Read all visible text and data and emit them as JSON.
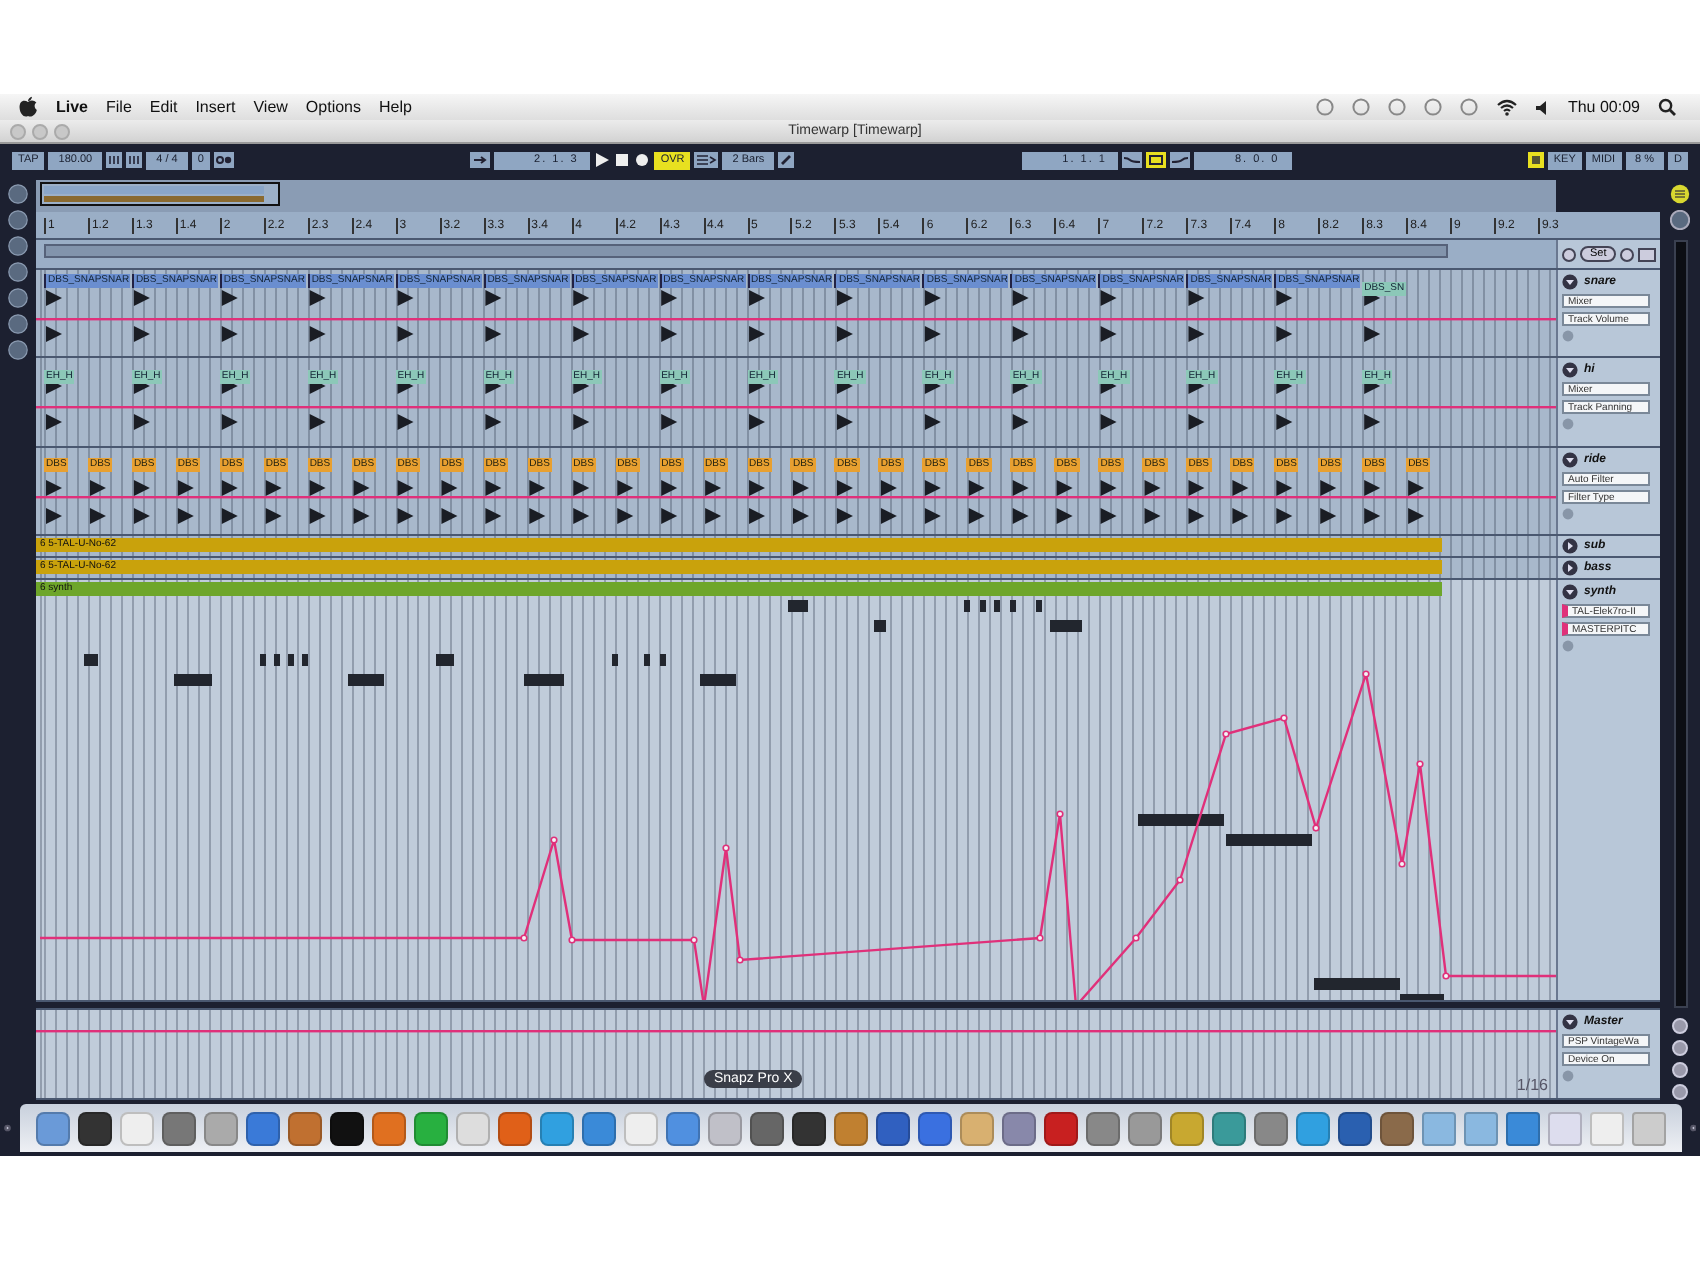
{
  "menu_bar": {
    "app": "Live",
    "items": [
      "File",
      "Edit",
      "Insert",
      "View",
      "Options",
      "Help"
    ],
    "clock": "Thu 00:09"
  },
  "window": {
    "title": "Timewarp [Timewarp]"
  },
  "transport": {
    "tap": "TAP",
    "tempo": "180.00",
    "signature": "4 / 4",
    "metronome": "0",
    "position": "2. 1. 3",
    "overdub": {
      "label": "OVR",
      "on": true
    },
    "quantize": "2 Bars",
    "loop_start": "1. 1. 1",
    "loop_length": "8. 0. 0",
    "key": "KEY",
    "midi": "MIDI",
    "cpu": "8 %",
    "disk": "D"
  },
  "ruler": {
    "labels": [
      "1",
      "1.2",
      "1.3",
      "1.4",
      "2",
      "2.2",
      "2.3",
      "2.4",
      "3",
      "3.2",
      "3.3",
      "3.4",
      "4",
      "4.2",
      "4.3",
      "4.4",
      "5",
      "5.2",
      "5.3",
      "5.4",
      "6",
      "6.2",
      "6.3",
      "6.4",
      "7",
      "7.2",
      "7.3",
      "7.4",
      "8",
      "8.2",
      "8.3",
      "8.4",
      "9",
      "9.2",
      "9.3"
    ]
  },
  "locator": {
    "set": "Set"
  },
  "tracks": [
    {
      "name": "snare",
      "kind": "drum",
      "expanded": true,
      "device": "Mixer",
      "parameter": "Track Volume",
      "clips": [
        "DBS_SNAPSNAR",
        "DBS_SNAPSNAR",
        "DBS_SNAPSNAR",
        "DBS_SNAPSNAR",
        "DBS_SNAPSNAR",
        "DBS_SNAPSNAR",
        "DBS_SNAPSNAR",
        "DBS_SNAPSNAR",
        "DBS_SNAPSNAR",
        "DBS_SNAPSNAR",
        "DBS_SNAPSNAR",
        "DBS_SNAPSNAR",
        "DBS_SNAPSNAR",
        "DBS_SNAPSNAR",
        "DBS_SNAPSNAR",
        "DBS_SN"
      ]
    },
    {
      "name": "hi",
      "kind": "drum",
      "expanded": true,
      "device": "Mixer",
      "parameter": "Track Panning",
      "clips": [
        "EH_H",
        "EH_H",
        "EH_H",
        "EH_H",
        "EH_H",
        "EH_H",
        "EH_H",
        "EH_H",
        "EH_H",
        "EH_H",
        "EH_H",
        "EH_H",
        "EH_H",
        "EH_H",
        "EH_H",
        "EH_H"
      ]
    },
    {
      "name": "ride",
      "kind": "hits",
      "expanded": true,
      "device": "Auto Filter",
      "parameter": "Filter Type",
      "clips": [
        "DBS",
        "DBS",
        "DBS",
        "DBS",
        "DBS",
        "DBS",
        "DBS",
        "DBS",
        "DBS",
        "DBS",
        "DBS",
        "DBS",
        "DBS",
        "DBS",
        "DBS",
        "DBS",
        "DBS",
        "DBS",
        "DBS",
        "DBS",
        "DBS",
        "DBS",
        "DBS",
        "DBS",
        "DBS",
        "DBS",
        "DBS",
        "DBS",
        "DBS",
        "DBS",
        "DBS",
        "DBS"
      ]
    },
    {
      "name": "sub",
      "kind": "midi",
      "expanded": false,
      "clip": {
        "label": "6 5-TAL-U-No-62",
        "color": "#c9a20c"
      }
    },
    {
      "name": "bass",
      "kind": "midi",
      "expanded": false,
      "clip": {
        "label": "6 5-TAL-U-No-62",
        "color": "#c9a20c"
      }
    },
    {
      "name": "synth",
      "kind": "midi",
      "expanded": true,
      "device": "TAL-Elek7ro-II",
      "parameter": "MASTERPITC",
      "clip": {
        "label": "6 synth",
        "color": "#6ea62a"
      }
    }
  ],
  "master": {
    "name": "Master",
    "device": "PSP VintageWa",
    "parameter": "Device On",
    "grid": "1/16"
  },
  "dock": {
    "tooltip": "Snapz Pro X"
  }
}
